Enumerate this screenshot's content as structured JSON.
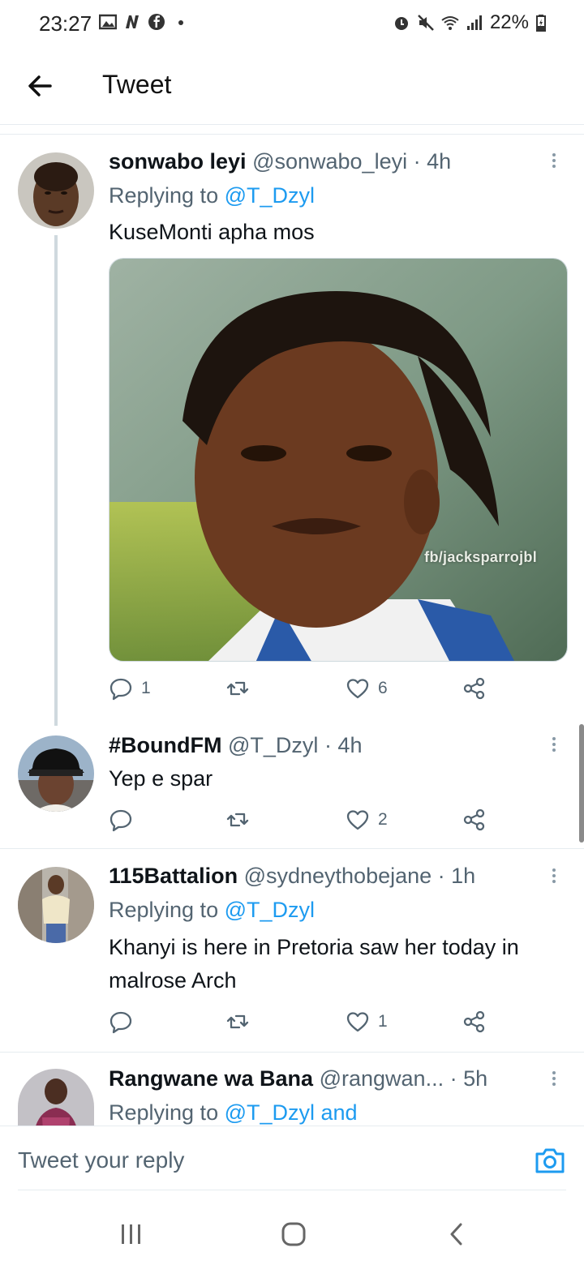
{
  "status_bar": {
    "time": "23:27",
    "battery": "22%"
  },
  "app_bar": {
    "title": "Tweet"
  },
  "tweets": [
    {
      "name": "sonwabo leyi",
      "handle": "@sonwabo_leyi",
      "time": "· 4h",
      "replying_prefix": "Replying to ",
      "replying_to": "@T_Dzyl",
      "text": "KuseMonti apha mos",
      "media_watermark": "fb/jacksparrojbl",
      "counts": {
        "reply": "1",
        "retweet": "",
        "like": "6"
      }
    },
    {
      "name": "#BoundFM",
      "handle": "@T_Dzyl",
      "time": "· 4h",
      "text": "Yep e spar",
      "counts": {
        "reply": "",
        "retweet": "",
        "like": "2"
      }
    },
    {
      "name": "115Battalion",
      "handle": "@sydneythobejane",
      "time": "· 1h",
      "replying_prefix": "Replying to ",
      "replying_to": "@T_Dzyl",
      "text": "Khanyi is here in Pretoria saw her today in malrose Arch",
      "counts": {
        "reply": "",
        "retweet": "",
        "like": "1"
      }
    },
    {
      "name": "Rangwane wa Bana",
      "handle": "@rangwan...",
      "time": "· 5h",
      "replying_prefix": "Replying to ",
      "replying_to": "@T_Dzyl and"
    }
  ],
  "composer": {
    "placeholder": "Tweet your reply"
  },
  "colors": {
    "link": "#1d9bf0",
    "secondary_text": "#536471",
    "primary_text": "#0f1419"
  }
}
